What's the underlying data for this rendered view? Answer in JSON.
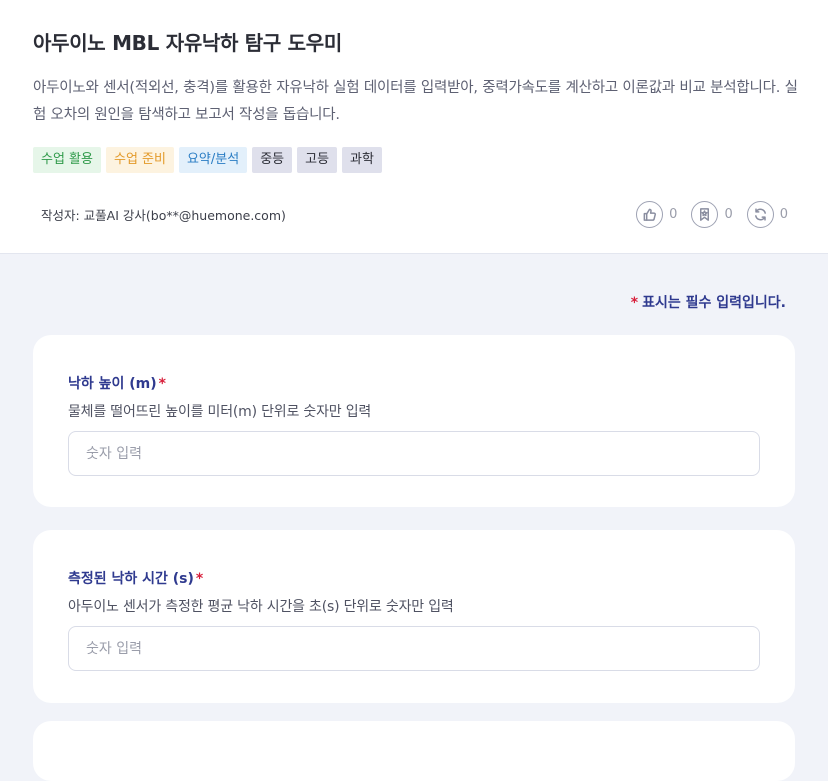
{
  "header": {
    "title": "아두이노 MBL 자유낙하 탐구 도우미",
    "description": "아두이노와 센서(적외선, 충격)를 활용한 자유낙하 실험 데이터를 입력받아, 중력가속도를 계산하고 이론값과 비교 분석합니다. 실험 오차의 원인을 탐색하고 보고서 작성을 돕습니다.",
    "tags": [
      {
        "label": "수업 활용",
        "bg": "#e6f6e9",
        "color": "#2f9a4a"
      },
      {
        "label": "수업 준비",
        "bg": "#fdf3e0",
        "color": "#e39a2a"
      },
      {
        "label": "요약/분석",
        "bg": "#e3f0fb",
        "color": "#2a7dc4"
      },
      {
        "label": "중등",
        "bg": "#dfe0ec",
        "color": "#2b2d36"
      },
      {
        "label": "고등",
        "bg": "#dfe0ec",
        "color": "#2b2d36"
      },
      {
        "label": "과학",
        "bg": "#dfe0ec",
        "color": "#2b2d36"
      }
    ],
    "author": "작성자: 교풀AI 강사(bo**@huemone.com)",
    "actions": [
      {
        "icon": "thumbs-up-icon",
        "count": "0"
      },
      {
        "icon": "bookmark-icon",
        "count": "0"
      },
      {
        "icon": "refresh-icon",
        "count": "0"
      }
    ]
  },
  "form": {
    "required_star": "*",
    "required_note": "표시는 필수 입력입니다.",
    "fields": [
      {
        "label": "낙하 높이 (m)",
        "required": "*",
        "help": "물체를 떨어뜨린 높이를 미터(m) 단위로 숫자만 입력",
        "placeholder": "숫자 입력",
        "value": ""
      },
      {
        "label": "측정된 낙하 시간 (s)",
        "required": "*",
        "help": "아두이노 센서가 측정한 평균 낙하 시간을 초(s) 단위로 숫자만 입력",
        "placeholder": "숫자 입력",
        "value": ""
      }
    ]
  },
  "colors": {
    "accent": "#2f3a8f",
    "required": "#d81e3a",
    "page_bg": "#f1f3f9"
  }
}
